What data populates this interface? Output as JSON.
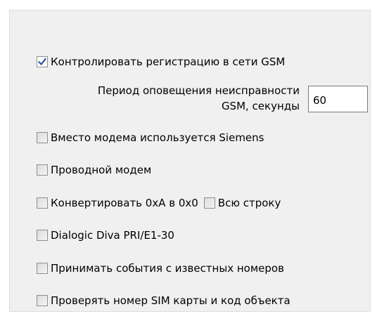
{
  "gsm_monitor": {
    "label": "Контролировать регистрацию в сети GSM",
    "checked": true,
    "period_label_line1": "Период оповещения неисправности",
    "period_label_line2": "GSM, секунды",
    "period_value": "60"
  },
  "options": {
    "siemens": {
      "label": "Вместо модема используется Siemens",
      "checked": false
    },
    "wired_modem": {
      "label": "Проводной модем",
      "checked": false
    },
    "convert_0xA": {
      "label": "Конвертировать 0xA в 0x0",
      "checked": false
    },
    "whole_line": {
      "label": "Всю строку",
      "checked": false
    },
    "dialogic": {
      "label": "Dialogic Diva PRI/E1-30",
      "checked": false
    },
    "known_numbers": {
      "label": "Принимать события с известных номеров",
      "checked": false
    },
    "check_sim": {
      "label": "Проверять номер SIM карты и код объекта",
      "checked": false
    }
  },
  "colors": {
    "panel_bg": "#f0f0f0",
    "checkmark": "#2d5aa6"
  },
  "icons": {
    "checkmark": "checkmark-icon"
  }
}
